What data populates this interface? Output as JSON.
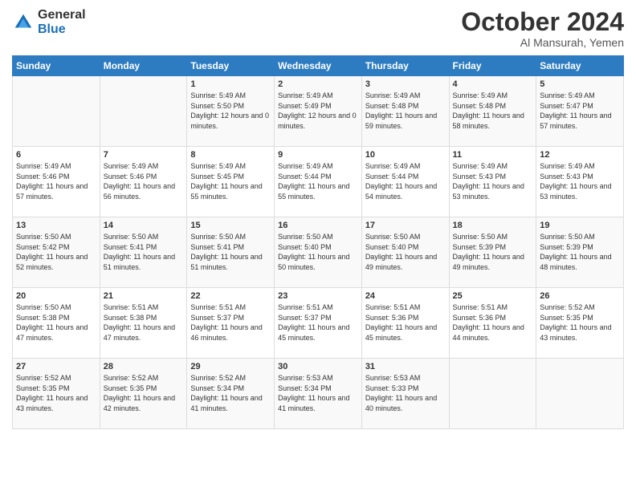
{
  "logo": {
    "general": "General",
    "blue": "Blue"
  },
  "title": {
    "month": "October 2024",
    "location": "Al Mansurah, Yemen"
  },
  "calendar": {
    "headers": [
      "Sunday",
      "Monday",
      "Tuesday",
      "Wednesday",
      "Thursday",
      "Friday",
      "Saturday"
    ],
    "rows": [
      [
        {
          "day": "",
          "sunrise": "",
          "sunset": "",
          "daylight": ""
        },
        {
          "day": "",
          "sunrise": "",
          "sunset": "",
          "daylight": ""
        },
        {
          "day": "1",
          "sunrise": "Sunrise: 5:49 AM",
          "sunset": "Sunset: 5:50 PM",
          "daylight": "Daylight: 12 hours and 0 minutes."
        },
        {
          "day": "2",
          "sunrise": "Sunrise: 5:49 AM",
          "sunset": "Sunset: 5:49 PM",
          "daylight": "Daylight: 12 hours and 0 minutes."
        },
        {
          "day": "3",
          "sunrise": "Sunrise: 5:49 AM",
          "sunset": "Sunset: 5:48 PM",
          "daylight": "Daylight: 11 hours and 59 minutes."
        },
        {
          "day": "4",
          "sunrise": "Sunrise: 5:49 AM",
          "sunset": "Sunset: 5:48 PM",
          "daylight": "Daylight: 11 hours and 58 minutes."
        },
        {
          "day": "5",
          "sunrise": "Sunrise: 5:49 AM",
          "sunset": "Sunset: 5:47 PM",
          "daylight": "Daylight: 11 hours and 57 minutes."
        }
      ],
      [
        {
          "day": "6",
          "sunrise": "Sunrise: 5:49 AM",
          "sunset": "Sunset: 5:46 PM",
          "daylight": "Daylight: 11 hours and 57 minutes."
        },
        {
          "day": "7",
          "sunrise": "Sunrise: 5:49 AM",
          "sunset": "Sunset: 5:46 PM",
          "daylight": "Daylight: 11 hours and 56 minutes."
        },
        {
          "day": "8",
          "sunrise": "Sunrise: 5:49 AM",
          "sunset": "Sunset: 5:45 PM",
          "daylight": "Daylight: 11 hours and 55 minutes."
        },
        {
          "day": "9",
          "sunrise": "Sunrise: 5:49 AM",
          "sunset": "Sunset: 5:44 PM",
          "daylight": "Daylight: 11 hours and 55 minutes."
        },
        {
          "day": "10",
          "sunrise": "Sunrise: 5:49 AM",
          "sunset": "Sunset: 5:44 PM",
          "daylight": "Daylight: 11 hours and 54 minutes."
        },
        {
          "day": "11",
          "sunrise": "Sunrise: 5:49 AM",
          "sunset": "Sunset: 5:43 PM",
          "daylight": "Daylight: 11 hours and 53 minutes."
        },
        {
          "day": "12",
          "sunrise": "Sunrise: 5:49 AM",
          "sunset": "Sunset: 5:43 PM",
          "daylight": "Daylight: 11 hours and 53 minutes."
        }
      ],
      [
        {
          "day": "13",
          "sunrise": "Sunrise: 5:50 AM",
          "sunset": "Sunset: 5:42 PM",
          "daylight": "Daylight: 11 hours and 52 minutes."
        },
        {
          "day": "14",
          "sunrise": "Sunrise: 5:50 AM",
          "sunset": "Sunset: 5:41 PM",
          "daylight": "Daylight: 11 hours and 51 minutes."
        },
        {
          "day": "15",
          "sunrise": "Sunrise: 5:50 AM",
          "sunset": "Sunset: 5:41 PM",
          "daylight": "Daylight: 11 hours and 51 minutes."
        },
        {
          "day": "16",
          "sunrise": "Sunrise: 5:50 AM",
          "sunset": "Sunset: 5:40 PM",
          "daylight": "Daylight: 11 hours and 50 minutes."
        },
        {
          "day": "17",
          "sunrise": "Sunrise: 5:50 AM",
          "sunset": "Sunset: 5:40 PM",
          "daylight": "Daylight: 11 hours and 49 minutes."
        },
        {
          "day": "18",
          "sunrise": "Sunrise: 5:50 AM",
          "sunset": "Sunset: 5:39 PM",
          "daylight": "Daylight: 11 hours and 49 minutes."
        },
        {
          "day": "19",
          "sunrise": "Sunrise: 5:50 AM",
          "sunset": "Sunset: 5:39 PM",
          "daylight": "Daylight: 11 hours and 48 minutes."
        }
      ],
      [
        {
          "day": "20",
          "sunrise": "Sunrise: 5:50 AM",
          "sunset": "Sunset: 5:38 PM",
          "daylight": "Daylight: 11 hours and 47 minutes."
        },
        {
          "day": "21",
          "sunrise": "Sunrise: 5:51 AM",
          "sunset": "Sunset: 5:38 PM",
          "daylight": "Daylight: 11 hours and 47 minutes."
        },
        {
          "day": "22",
          "sunrise": "Sunrise: 5:51 AM",
          "sunset": "Sunset: 5:37 PM",
          "daylight": "Daylight: 11 hours and 46 minutes."
        },
        {
          "day": "23",
          "sunrise": "Sunrise: 5:51 AM",
          "sunset": "Sunset: 5:37 PM",
          "daylight": "Daylight: 11 hours and 45 minutes."
        },
        {
          "day": "24",
          "sunrise": "Sunrise: 5:51 AM",
          "sunset": "Sunset: 5:36 PM",
          "daylight": "Daylight: 11 hours and 45 minutes."
        },
        {
          "day": "25",
          "sunrise": "Sunrise: 5:51 AM",
          "sunset": "Sunset: 5:36 PM",
          "daylight": "Daylight: 11 hours and 44 minutes."
        },
        {
          "day": "26",
          "sunrise": "Sunrise: 5:52 AM",
          "sunset": "Sunset: 5:35 PM",
          "daylight": "Daylight: 11 hours and 43 minutes."
        }
      ],
      [
        {
          "day": "27",
          "sunrise": "Sunrise: 5:52 AM",
          "sunset": "Sunset: 5:35 PM",
          "daylight": "Daylight: 11 hours and 43 minutes."
        },
        {
          "day": "28",
          "sunrise": "Sunrise: 5:52 AM",
          "sunset": "Sunset: 5:35 PM",
          "daylight": "Daylight: 11 hours and 42 minutes."
        },
        {
          "day": "29",
          "sunrise": "Sunrise: 5:52 AM",
          "sunset": "Sunset: 5:34 PM",
          "daylight": "Daylight: 11 hours and 41 minutes."
        },
        {
          "day": "30",
          "sunrise": "Sunrise: 5:53 AM",
          "sunset": "Sunset: 5:34 PM",
          "daylight": "Daylight: 11 hours and 41 minutes."
        },
        {
          "day": "31",
          "sunrise": "Sunrise: 5:53 AM",
          "sunset": "Sunset: 5:33 PM",
          "daylight": "Daylight: 11 hours and 40 minutes."
        },
        {
          "day": "",
          "sunrise": "",
          "sunset": "",
          "daylight": ""
        },
        {
          "day": "",
          "sunrise": "",
          "sunset": "",
          "daylight": ""
        }
      ]
    ]
  }
}
